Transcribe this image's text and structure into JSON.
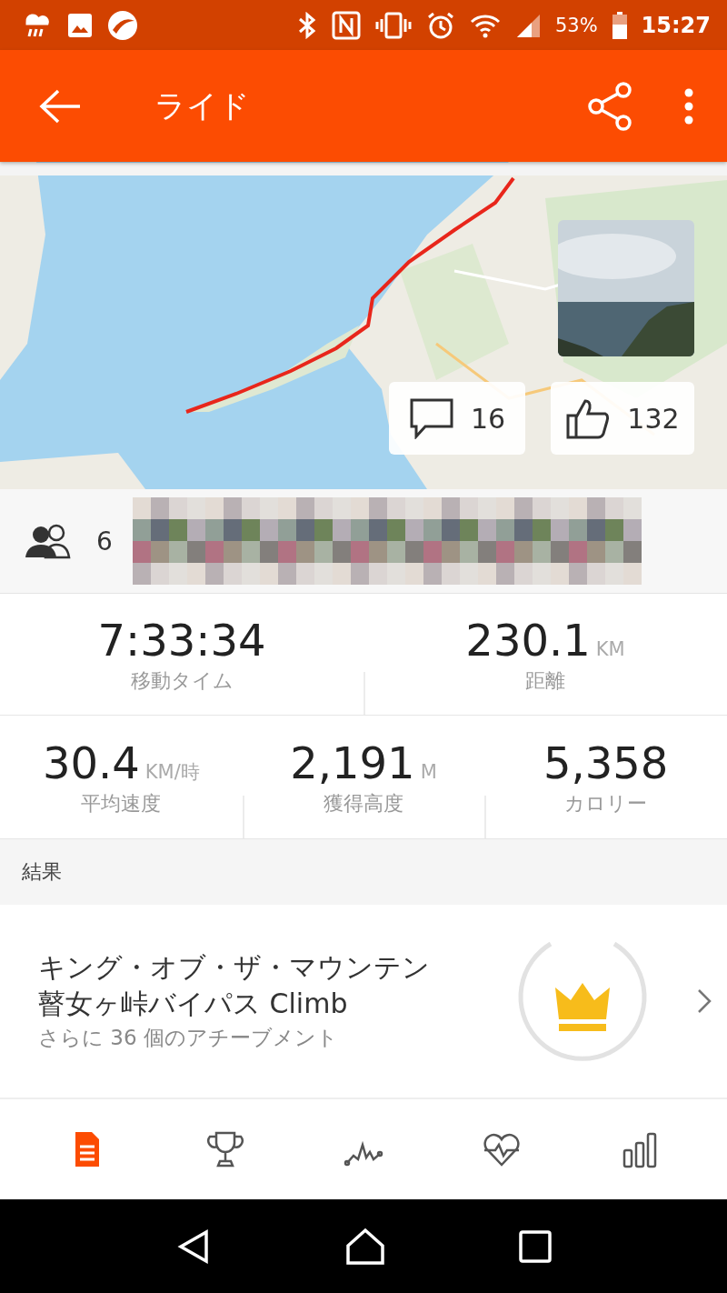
{
  "status_bar": {
    "battery": "53%",
    "time": "15:27"
  },
  "app_bar": {
    "title": "ライド"
  },
  "map": {
    "kind": "picture",
    "comments": "16",
    "kudos": "132"
  },
  "athletes": {
    "count": "6"
  },
  "stats": [
    [
      {
        "value": "7:33:34",
        "label": "移動タイム"
      },
      {
        "value": "230.1",
        "unit": "KM",
        "label": "距離"
      }
    ],
    [
      {
        "value": "30.4",
        "unit": "KM/時",
        "label": "平均速度"
      },
      {
        "value": "2,191",
        "unit": "M",
        "label": "獲得高度"
      },
      {
        "value": "5,358",
        "label": "カロリー"
      }
    ]
  ],
  "section_header": "結果",
  "achievement": {
    "title": "キング・オブ・ザ・マウンテン",
    "segment": "瞽女ヶ峠バイパス Climb",
    "more": "さらに 36 個のアチーブメント"
  },
  "tabs": [
    {
      "selected": true
    },
    {
      "selected": false
    },
    {
      "selected": false
    },
    {
      "selected": false
    },
    {
      "selected": false
    }
  ]
}
